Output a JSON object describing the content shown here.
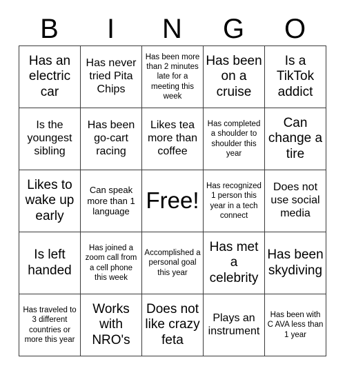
{
  "title": "BINGO",
  "header": {
    "letters": [
      "B",
      "I",
      "N",
      "G",
      "O"
    ]
  },
  "grid": {
    "columns": 5,
    "rows": 5,
    "cells": [
      {
        "text": "Has an electric car",
        "size": "fs-lg"
      },
      {
        "text": "Has never tried Pita Chips",
        "size": "fs-md"
      },
      {
        "text": "Has been more than 2 minutes late for a meeting this week",
        "size": "fs-xs"
      },
      {
        "text": "Has been on a cruise",
        "size": "fs-lg"
      },
      {
        "text": "Is a TikTok addict",
        "size": "fs-lg"
      },
      {
        "text": "Is the youngest sibling",
        "size": "fs-md"
      },
      {
        "text": "Has been go-cart racing",
        "size": "fs-md"
      },
      {
        "text": "Likes tea more than coffee",
        "size": "fs-md"
      },
      {
        "text": "Has completed a shoulder to shoulder this year",
        "size": "fs-xs"
      },
      {
        "text": "Can change a tire",
        "size": "fs-lg"
      },
      {
        "text": "Likes to wake up early",
        "size": "fs-lg"
      },
      {
        "text": "Can speak more than 1 language",
        "size": "fs-sm"
      },
      {
        "text": "Free!",
        "size": "free"
      },
      {
        "text": "Has recognized 1 person this year in a tech connect",
        "size": "fs-xs"
      },
      {
        "text": "Does not use social media",
        "size": "fs-md"
      },
      {
        "text": "Is left handed",
        "size": "fs-lg"
      },
      {
        "text": "Has joined a zoom call from a cell phone this week",
        "size": "fs-xs"
      },
      {
        "text": "Accomplished a personal goal this year",
        "size": "fs-xs"
      },
      {
        "text": "Has met a celebrity",
        "size": "fs-lg"
      },
      {
        "text": "Has been skydiving",
        "size": "fs-lg"
      },
      {
        "text": "Has traveled to 3 different countries or more this year",
        "size": "fs-xs"
      },
      {
        "text": "Works with NRO's",
        "size": "fs-lg"
      },
      {
        "text": "Does not like crazy feta",
        "size": "fs-lg"
      },
      {
        "text": "Plays an instrument",
        "size": "fs-md"
      },
      {
        "text": "Has been with C AVA less than 1 year",
        "size": "fs-xs"
      }
    ]
  },
  "colors": {
    "background": "#ffffff",
    "text": "#000000",
    "grid_line": "#3a3a3a"
  }
}
